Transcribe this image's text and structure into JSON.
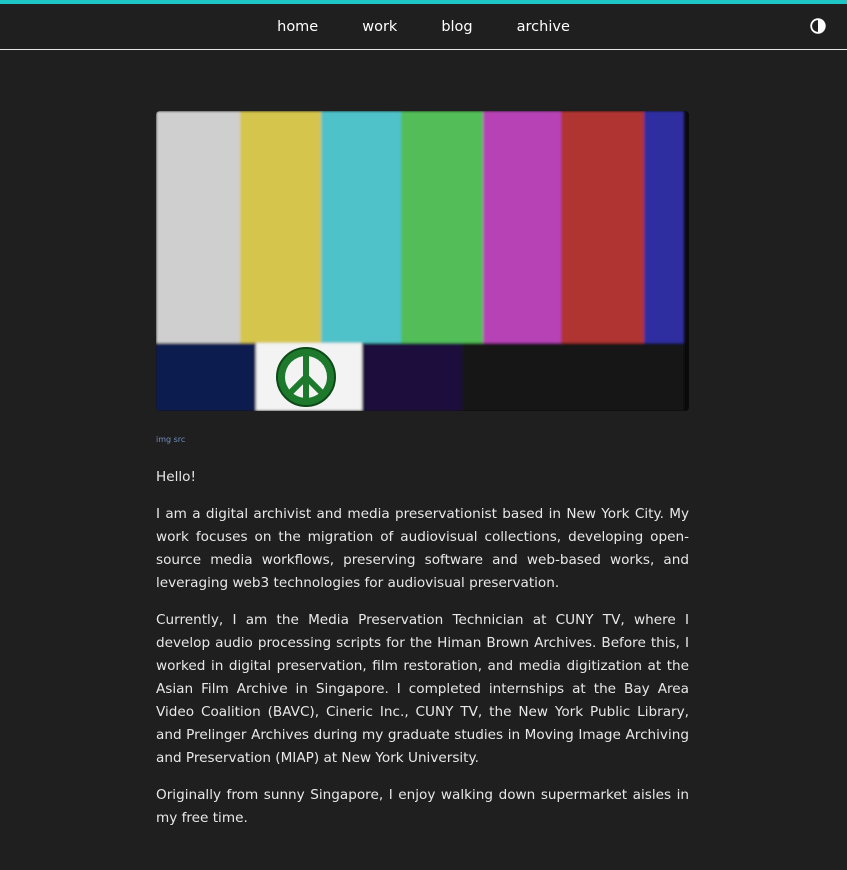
{
  "nav": {
    "items": [
      {
        "label": "home"
      },
      {
        "label": "work"
      },
      {
        "label": "blog"
      },
      {
        "label": "archive"
      }
    ],
    "theme_toggle_icon": "contrast-icon"
  },
  "colors": {
    "accent": "#1ec5c5",
    "background": "#1f1f1f",
    "link": "#6f8fc0"
  },
  "hero": {
    "icon": "peace-sign-icon",
    "caption_link": "img src"
  },
  "bio": {
    "greeting": "Hello!",
    "paragraphs": [
      "I am a digital archivist and media preservationist based in New York City. My work focuses on the migration of audiovisual collections, developing open-source media workflows, preserving software and web-based works, and leveraging web3 technologies for audiovisual preservation.",
      "Currently, I am the Media Preservation Technician at CUNY TV, where I develop audio processing scripts for the Himan Brown Archives. Before this, I worked in digital preservation, film restoration, and media digitization at the Asian Film Archive in Singapore. I completed internships at the Bay Area Video Coalition (BAVC), Cineric Inc., CUNY TV, the New York Public Library, and Prelinger Archives during my graduate studies in Moving Image Archiving and Preservation (MIAP) at New York University.",
      "Originally from sunny Singapore, I enjoy walking down supermarket aisles in my free time."
    ]
  }
}
